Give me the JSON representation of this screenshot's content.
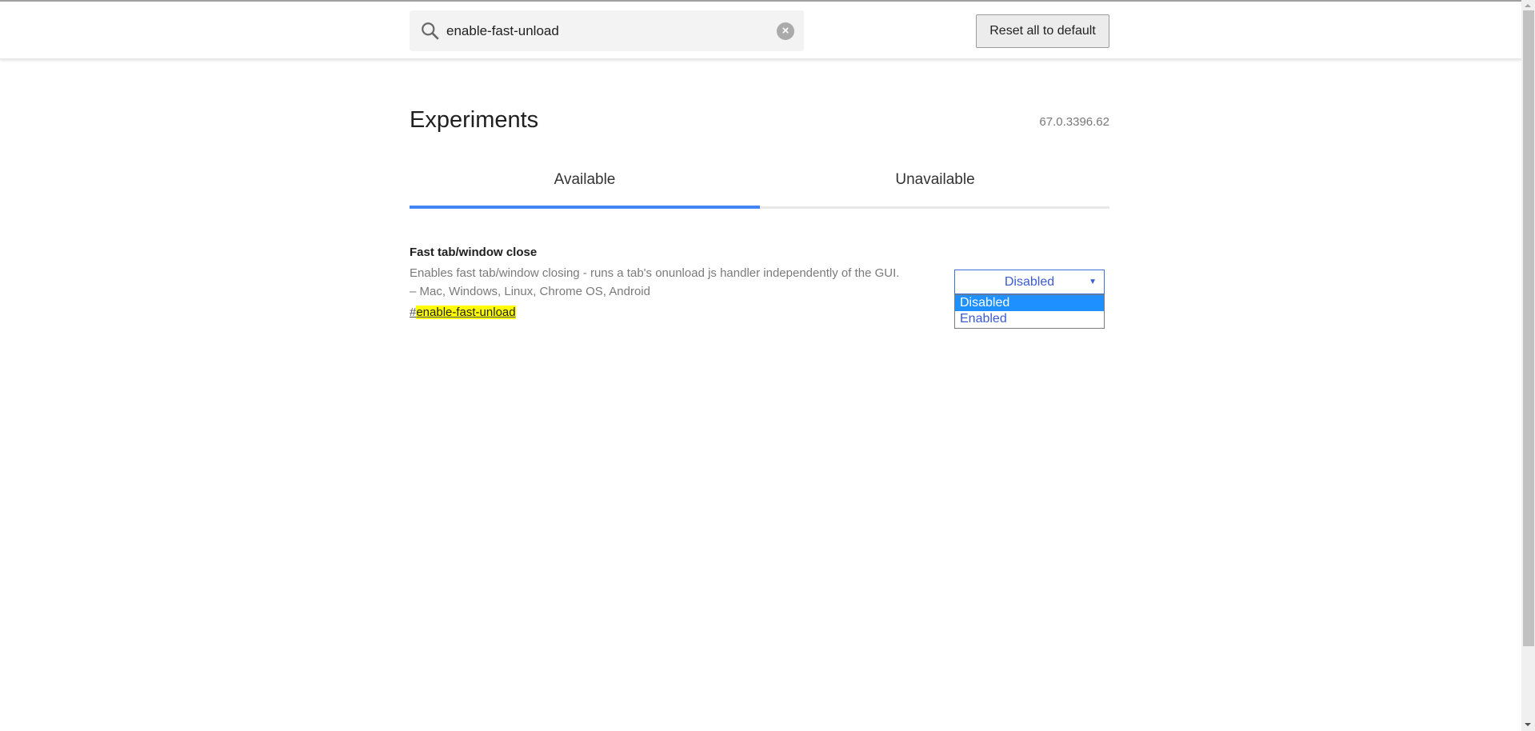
{
  "header": {
    "search_value": "enable-fast-unload",
    "reset_label": "Reset all to default"
  },
  "page": {
    "title": "Experiments",
    "version": "67.0.3396.62"
  },
  "tabs": [
    {
      "label": "Available",
      "active": true
    },
    {
      "label": "Unavailable",
      "active": false
    }
  ],
  "experiment": {
    "title": "Fast tab/window close",
    "description": "Enables fast tab/window closing - runs a tab's onunload js handler independently of the GUI.",
    "platforms": "– Mac, Windows, Linux, Chrome OS, Android",
    "hash": "#",
    "anchor": "enable-fast-unload",
    "selected": "Disabled",
    "options": [
      "Disabled",
      "Enabled"
    ]
  },
  "colors": {
    "accent": "#4285f4",
    "highlight": "#ffff00",
    "option_selected": "#1e90ff"
  }
}
